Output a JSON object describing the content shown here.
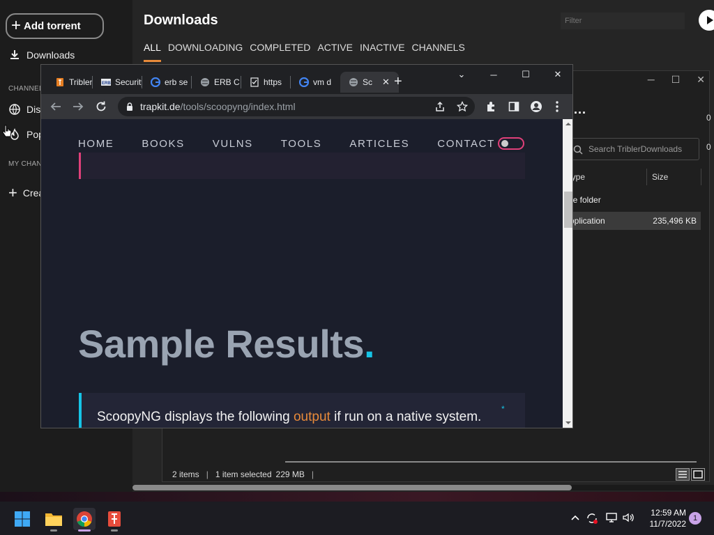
{
  "tribler": {
    "add_torrent": "Add torrent",
    "sidebar": {
      "downloads": "Downloads",
      "channels_head": "CHANNELS",
      "discover": "Discovered",
      "popular": "Popular",
      "my_channels_head": "MY CHANNELS",
      "create": "Create"
    },
    "title": "Downloads",
    "filter_placeholder": "Filter",
    "tabs": [
      "ALL",
      "DOWNLOADING",
      "COMPLETED",
      "ACTIVE",
      "INACTIVE",
      "CHANNELS"
    ],
    "active_tab": "ALL"
  },
  "explorer": {
    "more": "...",
    "search_placeholder": "Search TriblerDownloads",
    "columns": {
      "type": "Type",
      "size": "Size"
    },
    "rows": [
      {
        "type": "File folder",
        "size": ""
      },
      {
        "type": "Application",
        "size": "235,496 KB"
      }
    ],
    "status": {
      "items": "2 items",
      "selected": "1 item selected",
      "size": "229 MB"
    },
    "side_values": [
      "0",
      "0"
    ]
  },
  "chrome": {
    "tabs": [
      {
        "label": "Tribler",
        "icon": "tribler-icon"
      },
      {
        "label": "Security",
        "icon": "erb-icon"
      },
      {
        "label": "erb se",
        "icon": "google-icon"
      },
      {
        "label": "ERB C",
        "icon": "globe-icon"
      },
      {
        "label": "https",
        "icon": "check-doc-icon"
      },
      {
        "label": "vm d",
        "icon": "google-icon"
      },
      {
        "label": "Sc",
        "icon": "globe-icon",
        "active": true
      }
    ],
    "url_host": "trapkit.de",
    "url_path": "/tools/scoopyng/index.html",
    "page": {
      "nav": [
        "HOME",
        "BOOKS",
        "VULNS",
        "TOOLS",
        "ARTICLES",
        "CONTACT"
      ],
      "heading": "Sample Results",
      "heading_dot": ".",
      "callout_before": "ScoopyNG displays the following ",
      "callout_highlight": "output",
      "callout_after": " if run on a native system.",
      "callout_star": "*"
    }
  },
  "taskbar": {
    "time": "12:59 AM",
    "date": "11/7/2022",
    "notifications": "1"
  },
  "colors": {
    "accent_orange": "#e88a3a",
    "accent_cyan": "#16c4e6",
    "accent_pink": "#e0407a"
  }
}
